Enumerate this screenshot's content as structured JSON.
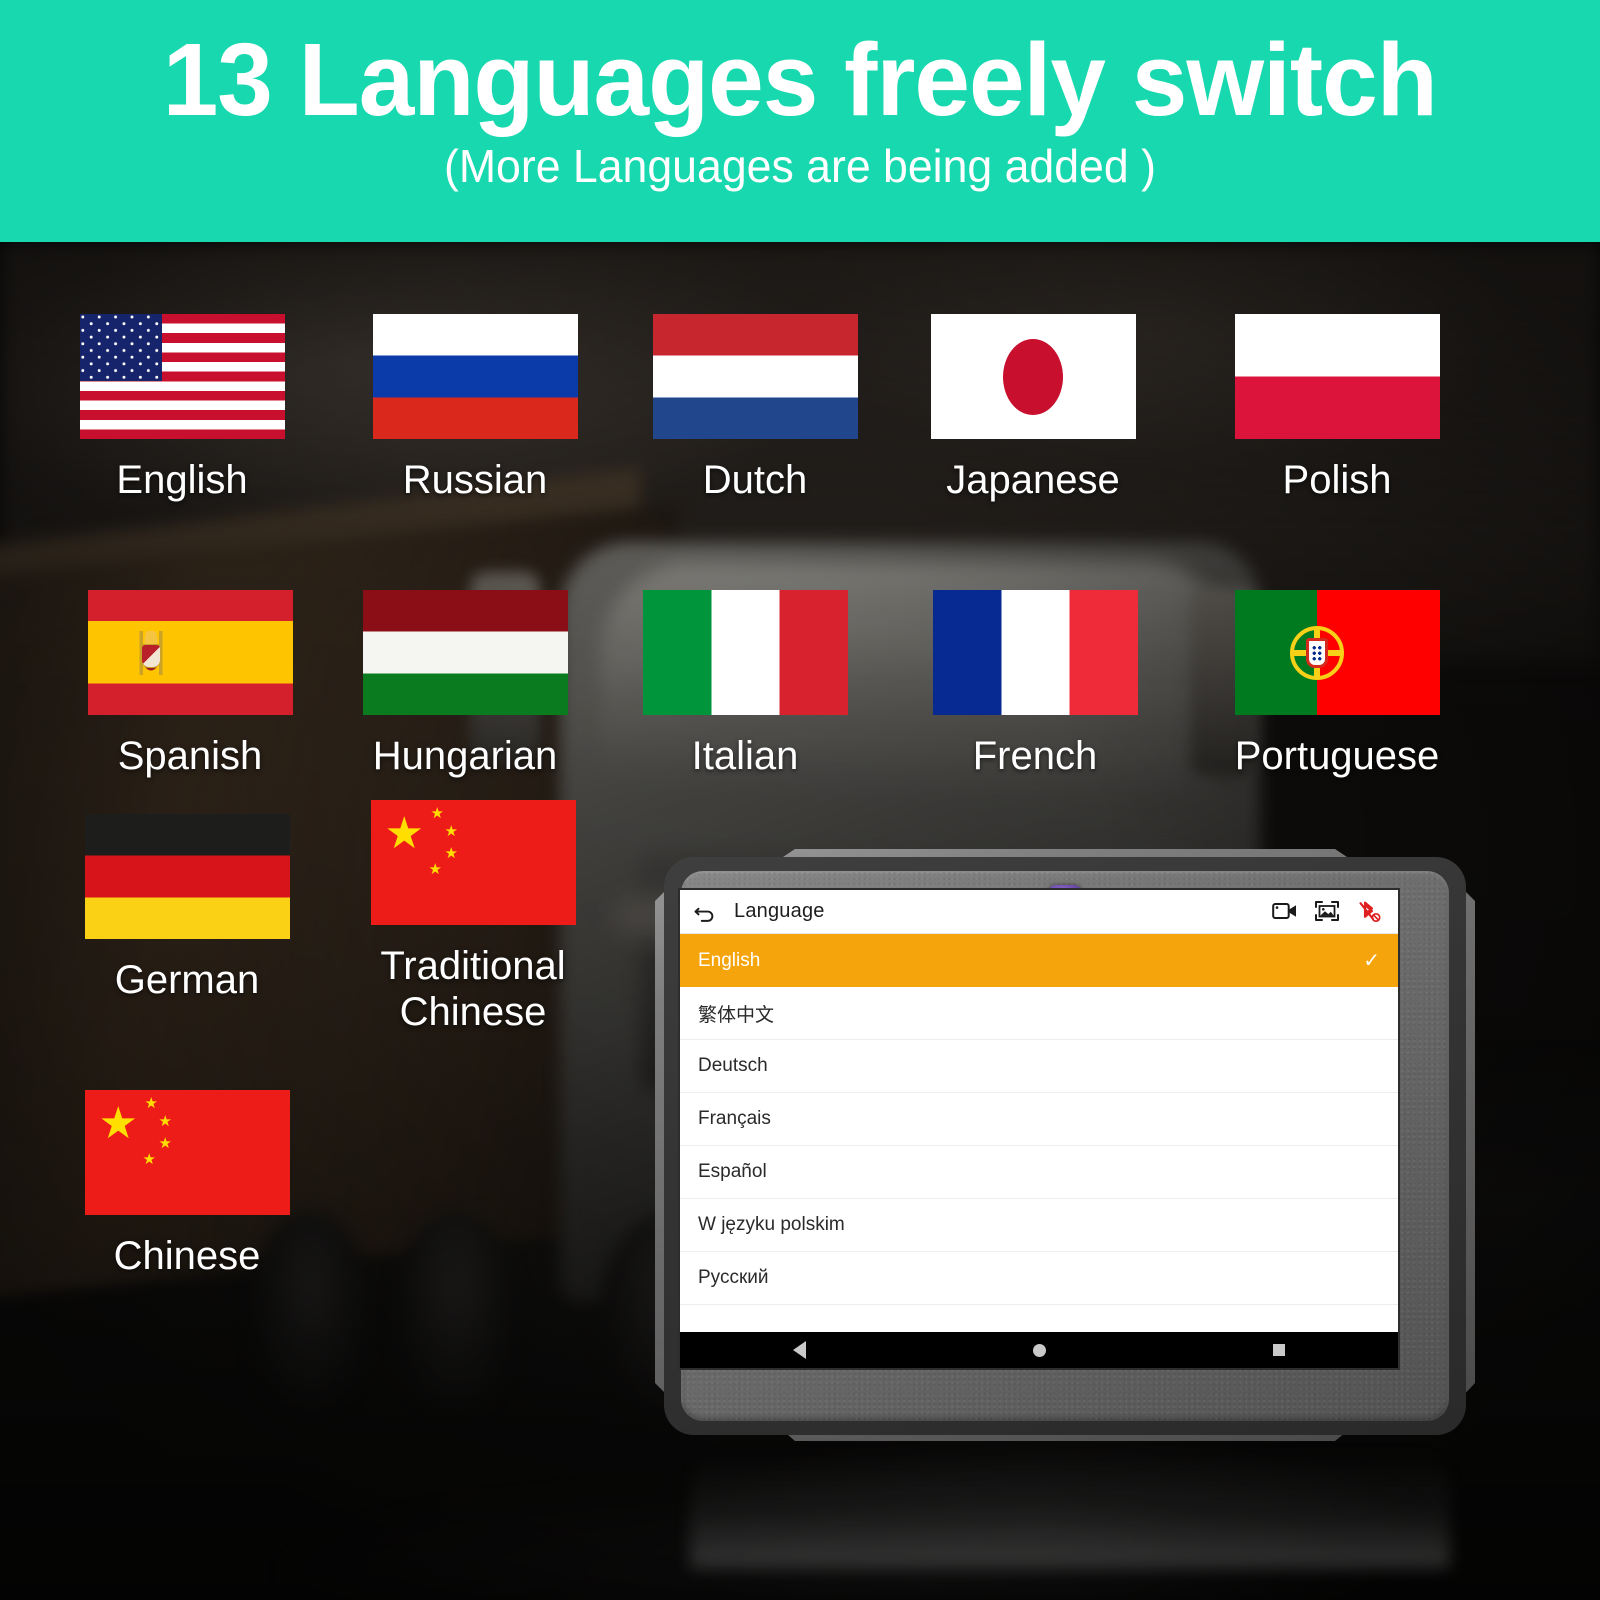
{
  "header": {
    "title": "13 Languages freely switch",
    "subtitle": "(More Languages are being added )",
    "band_color": "#17D8AE",
    "text_color": "#FFFFFF"
  },
  "flag_grid": {
    "items": [
      {
        "label": "English",
        "flag": "united-states-flag"
      },
      {
        "label": "Russian",
        "flag": "russia-flag"
      },
      {
        "label": "Dutch",
        "flag": "netherlands-flag"
      },
      {
        "label": "Japanese",
        "flag": "japan-flag"
      },
      {
        "label": "Polish",
        "flag": "poland-flag"
      },
      {
        "label": "Spanish",
        "flag": "spain-flag"
      },
      {
        "label": "Hungarian",
        "flag": "hungary-flag"
      },
      {
        "label": "Italian",
        "flag": "italy-flag"
      },
      {
        "label": "French",
        "flag": "france-flag"
      },
      {
        "label": "Portuguese",
        "flag": "portugal-flag"
      },
      {
        "label": "German",
        "flag": "germany-flag"
      },
      {
        "label": "Traditional\nChinese",
        "flag": "china-flag"
      },
      {
        "label": "Chinese",
        "flag": "china-flag"
      }
    ]
  },
  "tablet": {
    "device": "rugged-diagnostic-tablet",
    "appbar": {
      "back_icon": "back-arrow-icon",
      "title": "Language",
      "icons": [
        {
          "name": "video-record-icon",
          "color": "#1A1A1A"
        },
        {
          "name": "screenshot-image-icon",
          "color": "#1A1A1A"
        },
        {
          "name": "bluetooth-disabled-icon",
          "color": "#E02020"
        }
      ]
    },
    "language_list": {
      "selected_index": 0,
      "selected_color": "#F5A40C",
      "check_glyph": "✓",
      "rows": [
        {
          "label": "English",
          "selected": true
        },
        {
          "label": "繁体中文",
          "selected": false
        },
        {
          "label": "Deutsch",
          "selected": false
        },
        {
          "label": "Français",
          "selected": false
        },
        {
          "label": "Español",
          "selected": false
        },
        {
          "label": "W języku polskim",
          "selected": false
        },
        {
          "label": "Русский",
          "selected": false
        }
      ]
    },
    "navbar": {
      "buttons": [
        {
          "name": "android-back-button"
        },
        {
          "name": "android-home-button"
        },
        {
          "name": "android-recents-button"
        }
      ]
    }
  }
}
